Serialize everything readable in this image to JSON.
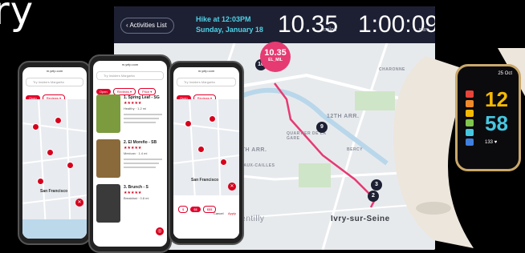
{
  "headline": "ry",
  "dashboard": {
    "back_label": "Activities List",
    "back_icon": "chevron-left-icon",
    "activity_title": "Hike at 12:03PM",
    "activity_date": "Sunday, January 18",
    "distance_value": "10.35",
    "distance_unit": "miles",
    "duration_value": "1:00:09",
    "duration_unit": "min",
    "pace_badge_value": "10.35",
    "pace_badge_label": "EL_MIL",
    "map_labels": [
      "12TH ARR.",
      "13TH ARR.",
      "QUARTIER DE LA GARE",
      "BUTTE-AUX-CAILLES",
      "CHARONNE",
      "BERCY",
      "Gentilly",
      "Ivry-sur-Seine"
    ],
    "route_markers": [
      "10",
      "9",
      "3",
      "2"
    ],
    "accent_color": "#e63a72",
    "header_color": "#1d2033"
  },
  "phones": [
    {
      "url": "m.yelp.com",
      "search_placeholder": "Try Insiders Margarita",
      "chips": [
        "Open",
        "Reviews ▾",
        "Price ▾",
        "Sort ▾"
      ],
      "city_label": "San Francisco"
    },
    {
      "url": "m.yelp.com",
      "search_placeholder": "Try Insiders Margarita",
      "chips": [
        "Open",
        "Reviews ▾",
        "Price ▾",
        "Sort ▾"
      ],
      "results": [
        {
          "title": "1. Spring Leaf - SG",
          "stars": "★★★★★",
          "meta": "Healthy · 1.2 mi"
        },
        {
          "title": "2. El Moreño - SB",
          "stars": "★★★★★",
          "meta": "Mexican · 1.4 mi"
        },
        {
          "title": "3. Brunch - S",
          "stars": "★★★★★",
          "meta": "Breakfast · 0.8 mi"
        }
      ]
    },
    {
      "url": "m.yelp.com",
      "search_placeholder": "Try Insiders Margarita",
      "chips": [
        "Open",
        "Reviews ▾",
        "Price ▾",
        "Sort ▾"
      ],
      "city_label": "San Francisco",
      "cancel_label": "Cancel",
      "apply_label": "Apply"
    }
  ],
  "watch": {
    "date": "25 Oct",
    "hours": "12",
    "minutes": "58",
    "heart_rate": "133 ♥",
    "zone_colors": [
      "#e8443a",
      "#f08a2a",
      "#f6b900",
      "#7fc64c",
      "#47c6e0",
      "#3f7fe0"
    ]
  }
}
